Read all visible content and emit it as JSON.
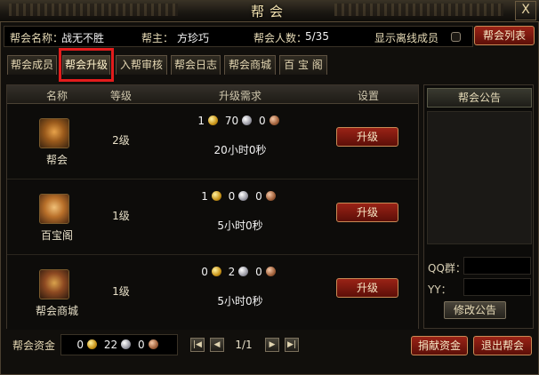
{
  "window": {
    "title": "帮会",
    "close_label": "X"
  },
  "info": {
    "guild_name_label": "帮会名称：",
    "guild_name": "战无不胜",
    "leader_label": "帮主：",
    "leader": "方珍巧",
    "members_label": "帮会人数：",
    "members": "5/35",
    "show_offline_label": "显示离线成员",
    "list_button": "帮会列表"
  },
  "tabs": [
    {
      "label": "帮会成员",
      "active": false
    },
    {
      "label": "帮会升级",
      "active": true
    },
    {
      "label": "入帮审核",
      "active": false
    },
    {
      "label": "帮会日志",
      "active": false
    },
    {
      "label": "帮会商城",
      "active": false
    },
    {
      "label": "百 宝 阁",
      "active": false
    }
  ],
  "table": {
    "headers": {
      "name": "名称",
      "level": "等级",
      "requirement": "升级需求",
      "settings": "设置"
    },
    "rows": [
      {
        "name": "帮会",
        "level": "2级",
        "gold": "1",
        "silver": "70",
        "copper": "0",
        "time": "20小时0秒",
        "button": "升级",
        "icon": "guild-hall-icon"
      },
      {
        "name": "百宝阁",
        "level": "1级",
        "gold": "1",
        "silver": "0",
        "copper": "0",
        "time": "5小时0秒",
        "button": "升级",
        "icon": "treasure-pavilion-icon"
      },
      {
        "name": "帮会商城",
        "level": "1级",
        "gold": "0",
        "silver": "2",
        "copper": "0",
        "time": "5小时0秒",
        "button": "升级",
        "icon": "guild-shop-icon"
      }
    ]
  },
  "side": {
    "notice_title": "帮会公告",
    "qq_label": "QQ群：",
    "yy_label": "YY：",
    "modify_button": "修改公告"
  },
  "footer": {
    "fund_label": "帮会资金",
    "fund_gold": "0",
    "fund_silver": "22",
    "fund_copper": "0",
    "page": "1/1",
    "donate_button": "捐献资金",
    "leave_button": "退出帮会"
  },
  "colors": {
    "accent_red": "#9a2316",
    "highlight_box": "#e31c1c",
    "gold": "#c89318",
    "silver": "#9a9aa4",
    "copper": "#a0603a"
  }
}
